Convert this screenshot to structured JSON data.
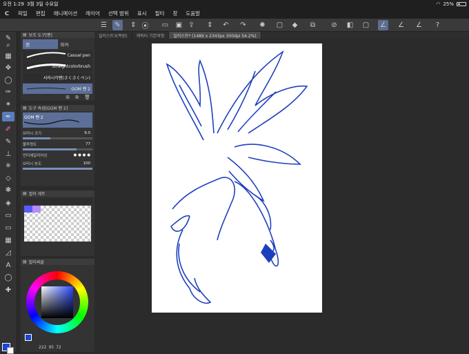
{
  "status": {
    "time": "오전 1:29",
    "date": "3월 3일 수요일",
    "battery": "25%"
  },
  "menu": [
    "파일",
    "편집",
    "애니메이션",
    "레이어",
    "선택 범위",
    "표시",
    "필터",
    "창",
    "도움말"
  ],
  "doc_tabs": [
    "일러스트3(복원)",
    "캐릭터 기본외형",
    "일러스트* (1489 x 2343px 300dpi 54.2%)"
  ],
  "subtool_panel": {
    "title": "보조 도구[펜]",
    "tabs": [
      "펜",
      "마커"
    ],
    "brushes": [
      "Casual pen",
      "Straightcolorbrush",
      "서라시각펜(さくさくペン)",
      "GOM 펜 2"
    ]
  },
  "tool_property": {
    "title": "도구 속성[GOM 펜 2]",
    "preview_name": "GOM 펜 2",
    "rows": [
      {
        "label": "브러시 크기",
        "value": "9.0",
        "level": 0.4
      },
      {
        "label": "불투명도",
        "value": "77",
        "level": 0.77
      },
      {
        "label": "안티에일리어싱",
        "value": "",
        "level": 0
      },
      {
        "label": "브러시 농도",
        "value": "100",
        "level": 1.0
      }
    ]
  },
  "color_set": {
    "title": "컬러 세트"
  },
  "color_wheel": {
    "title": "컬러써클",
    "values": {
      "h": "222",
      "s": "95",
      "v": "72"
    }
  },
  "colors": {
    "main": "#1b45d6",
    "sub": "#ffffff",
    "accent": "#5b6f98"
  },
  "icons": {
    "app": "clip-studio-logo"
  }
}
